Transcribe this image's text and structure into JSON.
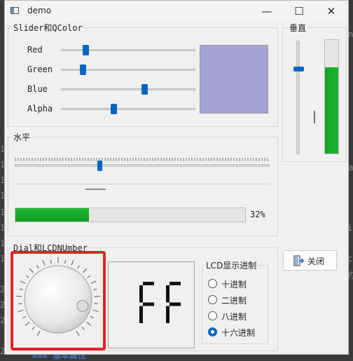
{
  "background": {
    "right_text": [
      "en",
      "ma",
      "i",
      "c",
      "的"
    ],
    "left_numbers": [
      "1",
      "1",
      "1",
      "1",
      "1",
      "1",
      "1",
      "1",
      "2",
      "2",
      "2",
      "2"
    ],
    "bottom_text": "### 基本属性"
  },
  "window": {
    "title": "demo",
    "minimize": "—",
    "maximize": "☐",
    "close": "✕"
  },
  "color_group": {
    "title": "Slider和QColor",
    "sliders": [
      {
        "label": "Red",
        "value": 0.17
      },
      {
        "label": "Green",
        "value": 0.15
      },
      {
        "label": "Blue",
        "value": 0.63
      },
      {
        "label": "Alpha",
        "value": 0.39
      }
    ],
    "preview_color": "#a6a3d4"
  },
  "vertical_group": {
    "title": "垂直",
    "slider_value": 0.76,
    "progress_value": 0.76,
    "progress_color": "#1aae2b"
  },
  "horizontal_group": {
    "title": "水平",
    "tick_slider_value": 0.33,
    "scroll_value": 0.3,
    "progress_value": 0.32,
    "progress_text": "32%"
  },
  "dial_group": {
    "title": "Dial和LCDNUmber",
    "dial_value": 0.85,
    "lcd_text": "FF",
    "radix_group": {
      "title": "LCD显示进制",
      "options": [
        {
          "label": "十进制",
          "checked": false
        },
        {
          "label": "二进制",
          "checked": false
        },
        {
          "label": "八进制",
          "checked": false
        },
        {
          "label": "十六进制",
          "checked": true
        }
      ]
    }
  },
  "close_button": {
    "label": "关闭",
    "icon": "exit-door-icon"
  },
  "highlight_color": "#e52222"
}
